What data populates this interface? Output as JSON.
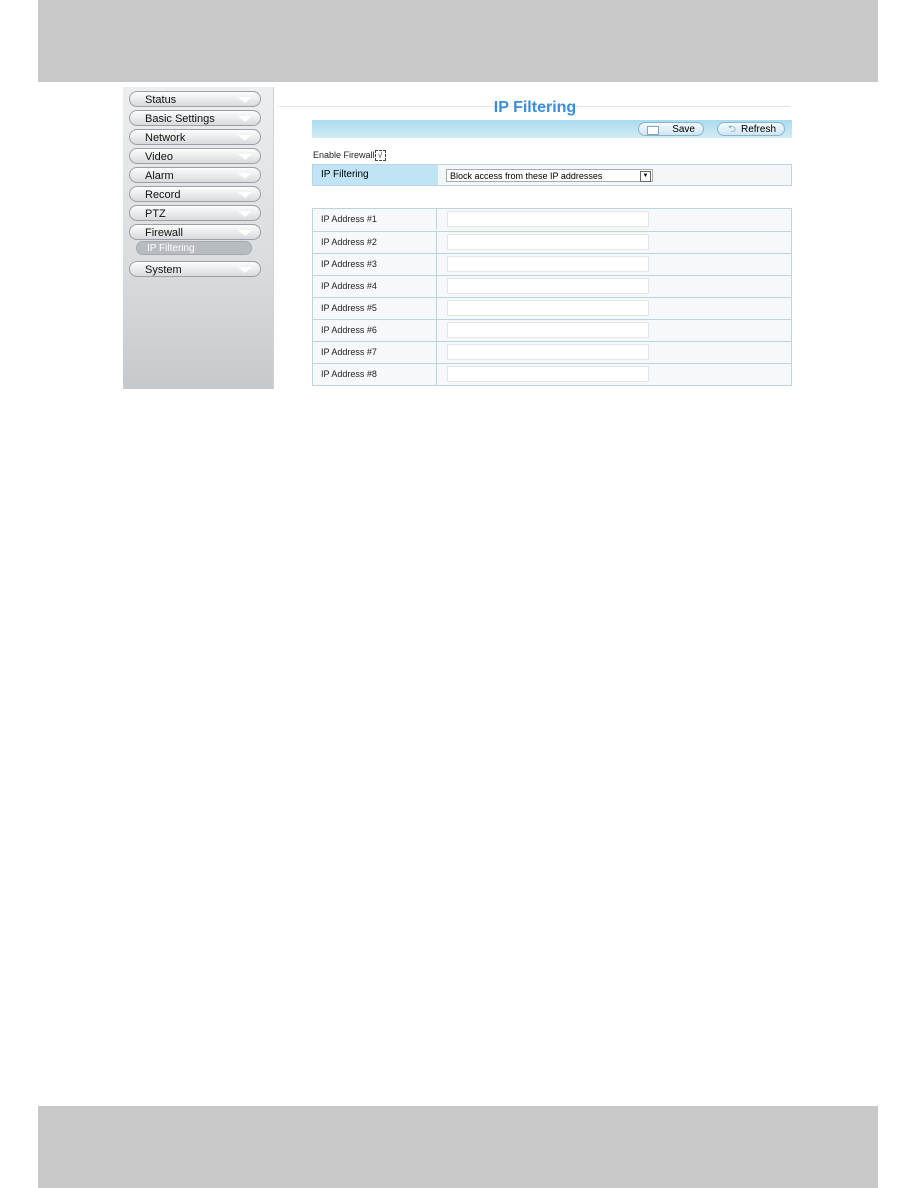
{
  "sidebar": {
    "items": [
      {
        "label": "Status"
      },
      {
        "label": "Basic Settings"
      },
      {
        "label": "Network"
      },
      {
        "label": "Video"
      },
      {
        "label": "Alarm"
      },
      {
        "label": "Record"
      },
      {
        "label": "PTZ"
      },
      {
        "label": "Firewall"
      },
      {
        "label": "System"
      }
    ],
    "subitem": "IP Filtering"
  },
  "main": {
    "title": "IP Filtering",
    "save_label": "Save",
    "refresh_label": "Refresh",
    "enable_firewall_label": "Enable Firewall",
    "enable_firewall_checked": "√",
    "filter_label": "IP Filtering",
    "filter_value": "Block access from these IP addresses",
    "addresses": [
      {
        "label": "IP Address #1",
        "value": ""
      },
      {
        "label": "IP Address #2",
        "value": ""
      },
      {
        "label": "IP Address #3",
        "value": ""
      },
      {
        "label": "IP Address #4",
        "value": ""
      },
      {
        "label": "IP Address #5",
        "value": ""
      },
      {
        "label": "IP Address #6",
        "value": ""
      },
      {
        "label": "IP Address #7",
        "value": ""
      },
      {
        "label": "IP Address #8",
        "value": ""
      }
    ]
  }
}
